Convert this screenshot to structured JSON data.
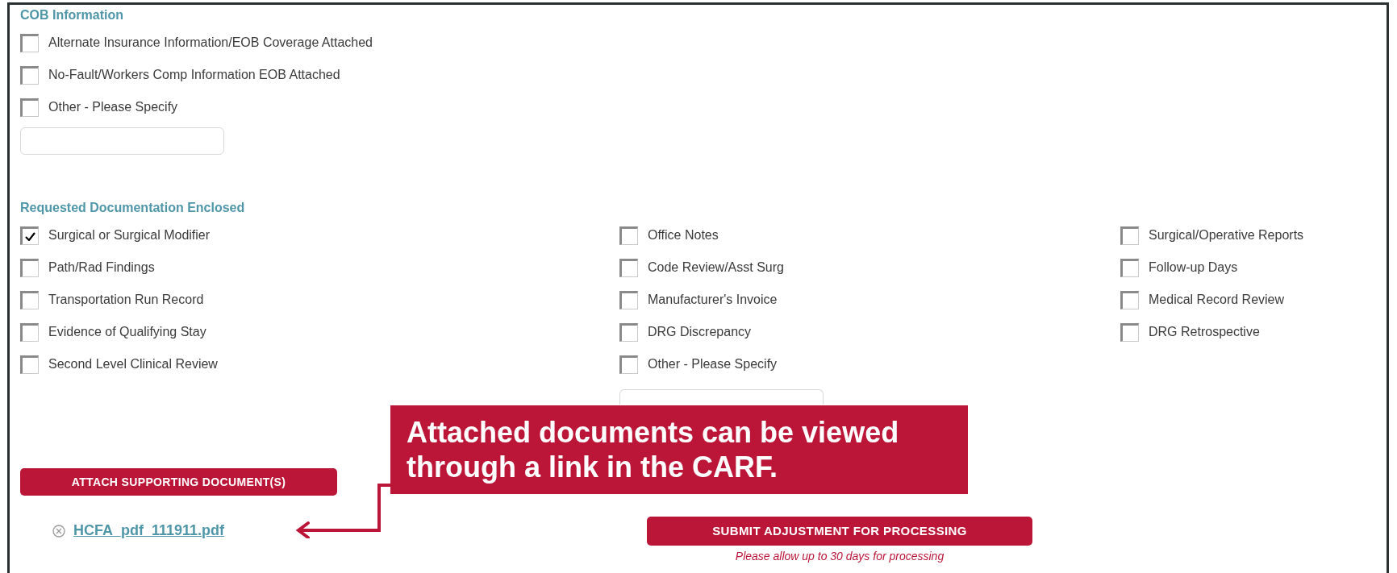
{
  "cob_section": {
    "heading": "COB Information",
    "options": [
      {
        "label": "Alternate Insurance Information/EOB Coverage Attached",
        "checked": false
      },
      {
        "label": "No-Fault/Workers Comp Information EOB Attached",
        "checked": false
      },
      {
        "label": "Other - Please Specify",
        "checked": false
      }
    ]
  },
  "documentation_section": {
    "heading": "Requested Documentation Enclosed",
    "columns": [
      [
        {
          "label": "Surgical or Surgical Modifier",
          "checked": true
        },
        {
          "label": "Path/Rad Findings",
          "checked": false
        },
        {
          "label": "Transportation Run Record",
          "checked": false
        },
        {
          "label": "Evidence of Qualifying Stay",
          "checked": false
        },
        {
          "label": "Second Level Clinical Review",
          "checked": false
        }
      ],
      [
        {
          "label": "Office Notes",
          "checked": false
        },
        {
          "label": "Code Review/Asst Surg",
          "checked": false
        },
        {
          "label": "Manufacturer's Invoice",
          "checked": false
        },
        {
          "label": "DRG Discrepancy",
          "checked": false
        },
        {
          "label": "Other - Please Specify",
          "checked": false
        }
      ],
      [
        {
          "label": "Surgical/Operative Reports",
          "checked": false
        },
        {
          "label": "Follow-up Days",
          "checked": false
        },
        {
          "label": "Medical Record Review",
          "checked": false
        },
        {
          "label": "DRG Retrospective",
          "checked": false
        }
      ]
    ]
  },
  "attach_button": "ATTACH SUPPORTING DOCUMENT(S)",
  "attachment": {
    "file_name": "HCFA_pdf_111911.pdf"
  },
  "submit_button": "SUBMIT ADJUSTMENT FOR PROCESSING",
  "submit_note": "Please allow up to 30 days for processing",
  "callout": "Attached documents can be viewed through a link in the CARF."
}
